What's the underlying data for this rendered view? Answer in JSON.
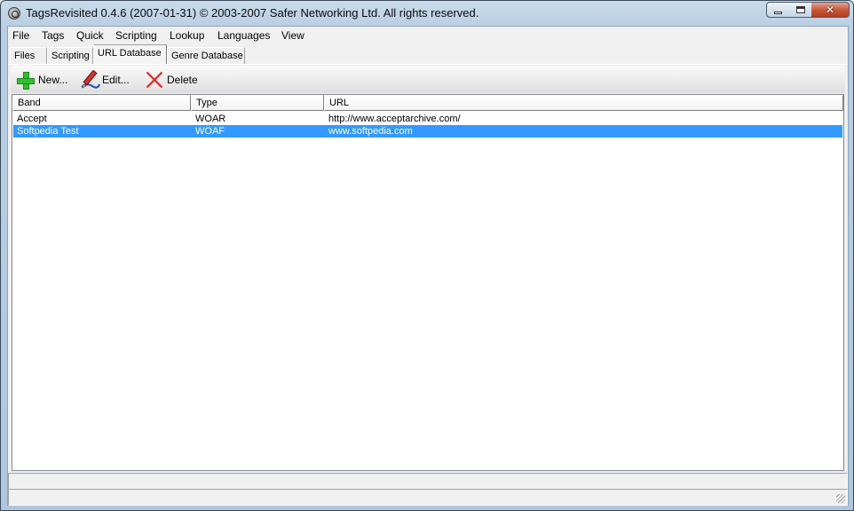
{
  "window": {
    "title": "TagsRevisited 0.4.6 (2007-01-31) © 2003-2007 Safer Networking Ltd. All rights reserved.",
    "controls": {
      "minimize": "minimize",
      "maximize": "maximize",
      "close": "✕"
    }
  },
  "menu": [
    "File",
    "Tags",
    "Quick",
    "Scripting",
    "Lookup",
    "Languages",
    "View"
  ],
  "tabs": [
    {
      "label": "Files",
      "active": false
    },
    {
      "label": "Scripting",
      "active": false
    },
    {
      "label": "URL Database",
      "active": true
    },
    {
      "label": "Genre Database",
      "active": false
    }
  ],
  "toolbar": {
    "new_label": "New...",
    "edit_label": "Edit...",
    "delete_label": "Delete",
    "icons": {
      "new": "plus-icon",
      "edit": "pencil-icon",
      "delete": "delete-x-icon"
    }
  },
  "list": {
    "columns": [
      "Band",
      "Type",
      "URL"
    ],
    "rows": [
      {
        "band": "Accept",
        "type": "WOAR",
        "url": "http://www.acceptarchive.com/",
        "selected": false
      },
      {
        "band": "Softpedia Test",
        "type": "WOAF",
        "url": "www.softpedia.com",
        "selected": true
      }
    ]
  },
  "colors": {
    "selection": "#3399ff",
    "plus": "#2fbf2f",
    "delete": "#e02020",
    "close_button": "#c75a3b"
  }
}
